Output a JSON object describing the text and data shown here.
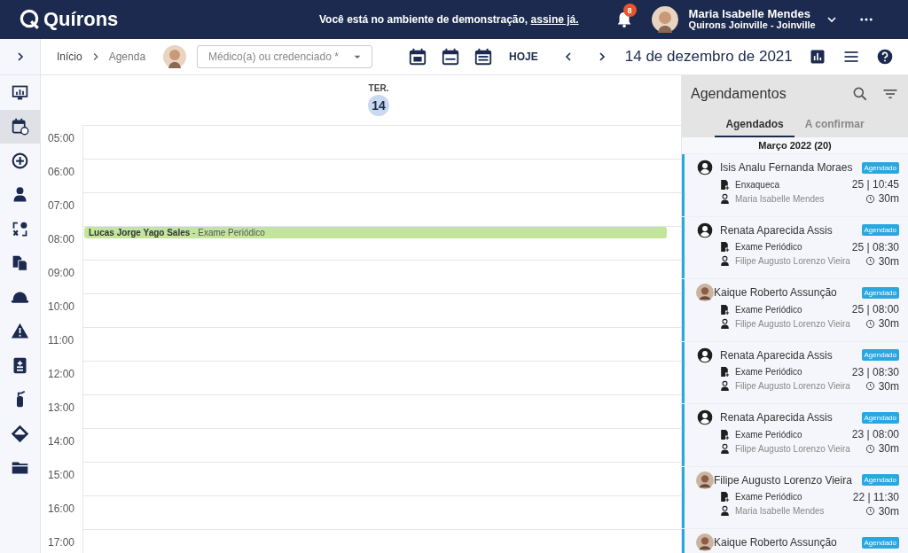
{
  "header": {
    "brand": "Quírons",
    "demo_notice": "Você está no ambiente de demonstração, ",
    "demo_link": "assine já.",
    "notifications": "8",
    "user_name": "Maria Isabelle Mendes",
    "user_unit": "Quirons Joinville - Joinville"
  },
  "sidebar": {
    "items": [
      {
        "selected": false
      },
      {
        "selected": true
      },
      {
        "selected": false
      },
      {
        "selected": false
      },
      {
        "selected": false
      },
      {
        "selected": false
      },
      {
        "selected": false
      },
      {
        "selected": false
      },
      {
        "selected": false
      },
      {
        "selected": false
      },
      {
        "selected": false
      },
      {
        "selected": false
      }
    ]
  },
  "toolbar": {
    "breadcrumbs": [
      "Início",
      "Agenda"
    ],
    "doctor_field": {
      "placeholder": "Médico(a) ou credenciado *"
    },
    "view_buttons": [
      {
        "selected": false
      },
      {
        "selected": false
      },
      {
        "selected": false
      }
    ],
    "today": "HOJE",
    "date": "14 de dezembro de 2021"
  },
  "day": {
    "weekday": "TER.",
    "number": "14"
  },
  "hours": [
    {
      "label": "05:00"
    },
    {
      "label": "06:00"
    },
    {
      "label": "07:00"
    },
    {
      "label": "08:00",
      "events": [
        {
          "text": "**Lucas Jorge Yago Sales** - Exame Periódico",
          "color": "#c3e59a"
        }
      ]
    },
    {
      "label": "09:00"
    },
    {
      "label": "10:00"
    },
    {
      "label": "11:00"
    },
    {
      "label": "12:00"
    },
    {
      "label": "13:00"
    },
    {
      "label": "14:00"
    },
    {
      "label": "15:00"
    },
    {
      "label": "16:00"
    },
    {
      "label": "17:00"
    }
  ],
  "panel": {
    "title": "Agendamentos",
    "tabs": [
      {
        "label": "Agendados",
        "selected": true
      },
      {
        "label": "A confirmar",
        "selected": false
      }
    ],
    "group": "Março 2022 (20)",
    "appointments": [
      {
        "kind": "icon",
        "patient": "Isis Analu Fernanda Moraes",
        "status": "Agendado",
        "reason": "Enxaqueca",
        "when": "25 | 10:45",
        "professional": "Maria Isabelle Mendes",
        "duration": "30m"
      },
      {
        "kind": "icon",
        "patient": "Renata Aparecida Assis",
        "status": "Agendado",
        "reason": "Exame Periódico",
        "when": "25 | 08:30",
        "professional": "Filipe Augusto Lorenzo Vieira",
        "duration": "30m"
      },
      {
        "kind": "photo",
        "patient": "Kaique Roberto Assunção",
        "status": "Agendado",
        "reason": "Exame Periódico",
        "when": "25 | 08:00",
        "professional": "Filipe Augusto Lorenzo Vieira",
        "duration": "30m"
      },
      {
        "kind": "icon",
        "patient": "Renata Aparecida Assis",
        "status": "Agendado",
        "reason": "Exame Periódico",
        "when": "23 | 08:30",
        "professional": "Filipe Augusto Lorenzo Vieira",
        "duration": "30m"
      },
      {
        "kind": "icon",
        "patient": "Renata Aparecida Assis",
        "status": "Agendado",
        "reason": "Exame Periódico",
        "when": "23 | 08:00",
        "professional": "Filipe Augusto Lorenzo Vieira",
        "duration": "30m"
      },
      {
        "kind": "photo",
        "patient": "Filipe Augusto Lorenzo Vieira",
        "status": "Agendado",
        "reason": "Exame Periódico",
        "when": "22 | 11:30",
        "professional": "Maria Isabelle Mendes",
        "duration": "30m"
      },
      {
        "kind": "photo",
        "patient": "Kaique Roberto Assunção",
        "status": "Agendado"
      }
    ]
  }
}
